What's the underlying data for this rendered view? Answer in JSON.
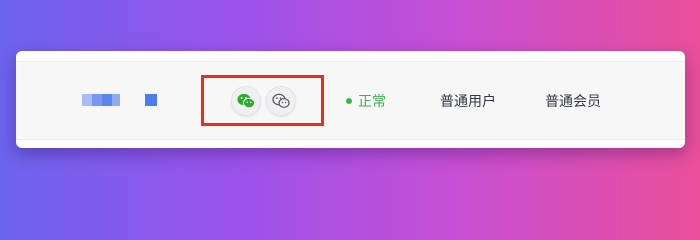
{
  "row": {
    "status": {
      "label": "正常",
      "color": "#3bb24a"
    },
    "user_type": "普通用户",
    "member_type": "普通会员",
    "bound_accounts": [
      {
        "icon": "wechat-icon",
        "color": "#2aae2a"
      },
      {
        "icon": "wechat-miniapp-icon",
        "color": "#555555"
      }
    ]
  },
  "colors": {
    "highlight": "#ef2b1e",
    "status_green": "#3bb24a"
  }
}
